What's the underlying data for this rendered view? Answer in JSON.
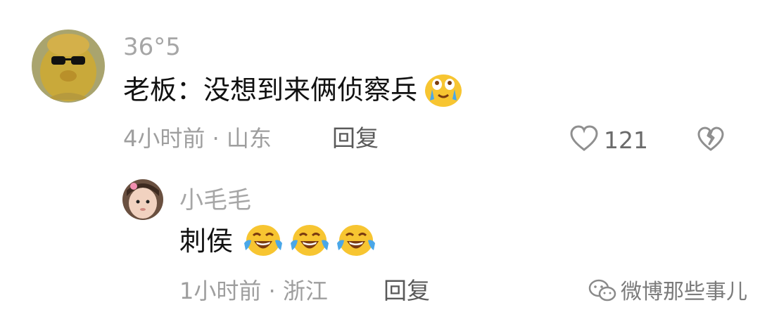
{
  "comments": [
    {
      "username": "36°5",
      "text": "老板：没想到来俩侦察兵",
      "emojis": [
        "emoji-crying-hopeful"
      ],
      "time_location": "4小时前 · 山东",
      "reply_label": "回复",
      "like_count": "121",
      "icons": [
        "heart-outline-icon",
        "broken-heart-icon"
      ]
    },
    {
      "username": "小毛毛",
      "text": "刺侯",
      "emojis": [
        "emoji-laugh-cry",
        "emoji-laugh-cry",
        "emoji-laugh-cry"
      ],
      "time_location": "1小时前 · 浙江",
      "reply_label": "回复"
    }
  ],
  "watermark": {
    "text": "微博那些事儿",
    "icon": "wechat-icon"
  },
  "colors": {
    "username": "#a6a6a6",
    "text": "#111111",
    "meta": "#9e9e9e",
    "emoji_yellow": "#f7c531",
    "tear_blue": "#4aa7e8"
  }
}
